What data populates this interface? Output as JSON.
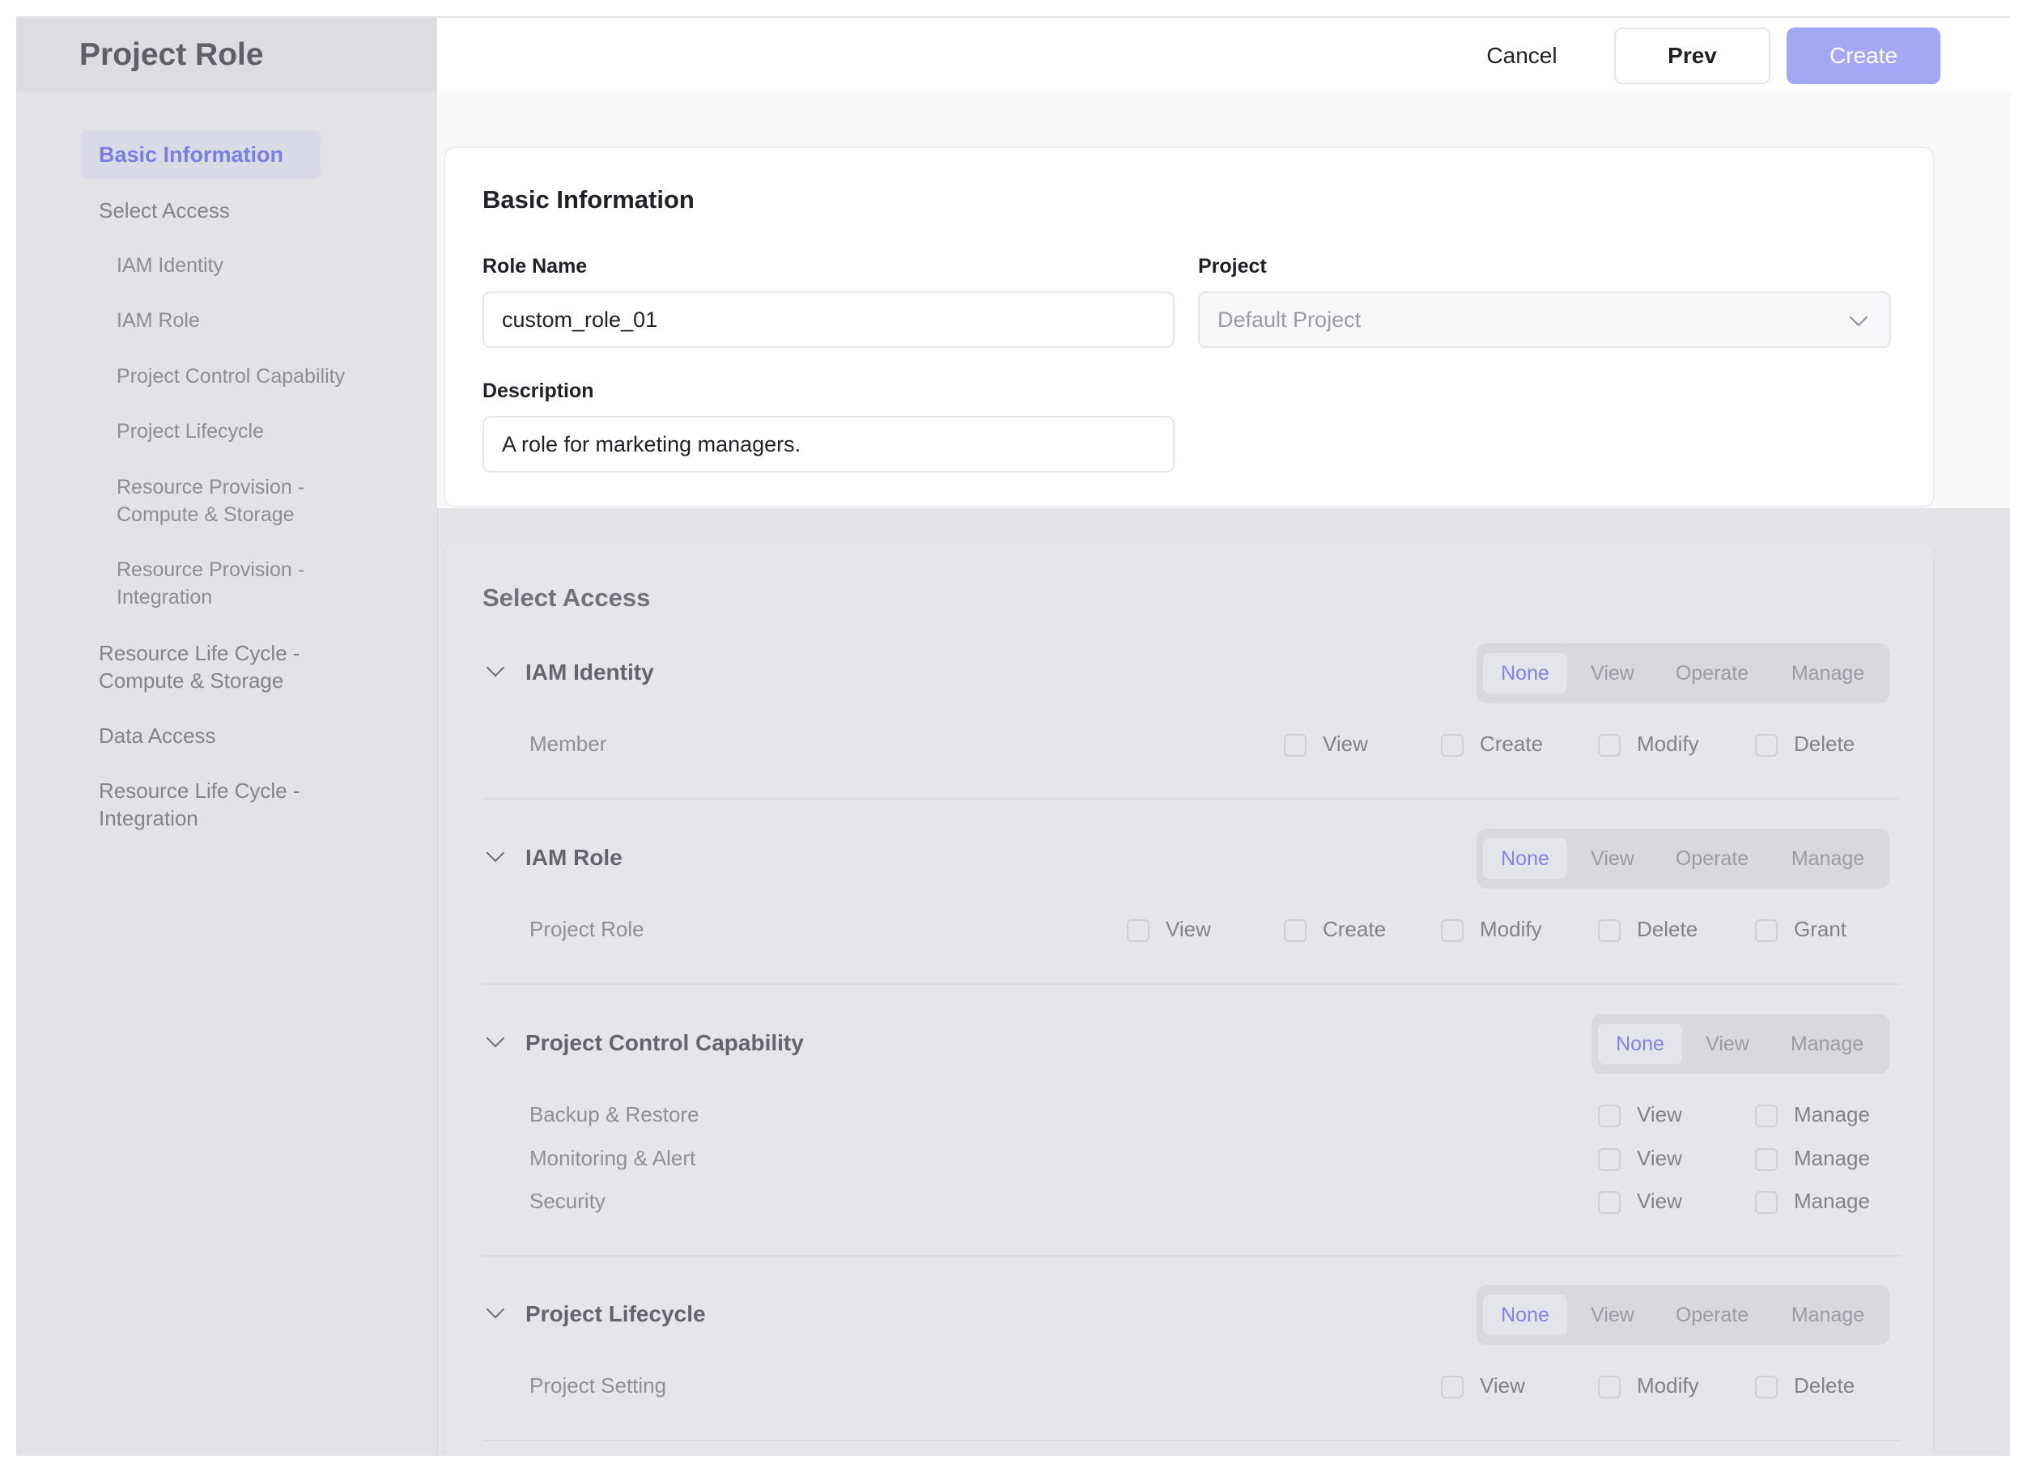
{
  "sidebar": {
    "title": "Project Role",
    "items": [
      {
        "label": "Basic Information"
      },
      {
        "label": "Select Access"
      },
      {
        "label": "IAM Identity"
      },
      {
        "label": "IAM Role"
      },
      {
        "label": "Project Control Capability"
      },
      {
        "label": "Project Lifecycle"
      },
      {
        "label": "Resource Provision -"
      },
      {
        "label": "Compute & Storage"
      },
      {
        "label": "Resource Provision -"
      },
      {
        "label": "Integration"
      },
      {
        "label": "Resource Life Cycle -"
      },
      {
        "label": "Compute & Storage"
      },
      {
        "label": "Data Access"
      },
      {
        "label": "Resource Life Cycle -"
      },
      {
        "label": "Integration"
      }
    ]
  },
  "header": {
    "cancel": "Cancel",
    "prev": "Prev",
    "create": "Create"
  },
  "basic": {
    "title": "Basic Information",
    "role_name_label": "Role Name",
    "role_name_value": "custom_role_01",
    "project_label": "Project",
    "project_value": "Default Project",
    "description_label": "Description",
    "description_value": "A role for marketing managers."
  },
  "access": {
    "title": "Select Access",
    "sections": [
      {
        "title": "IAM Identity",
        "levels": [
          "None",
          "View",
          "Operate",
          "Manage"
        ],
        "selected": "None",
        "rows": [
          {
            "label": "Member",
            "perms": [
              "View",
              "Create",
              "Modify",
              "Delete"
            ]
          }
        ]
      },
      {
        "title": "IAM Role",
        "levels": [
          "None",
          "View",
          "Operate",
          "Manage"
        ],
        "selected": "None",
        "rows": [
          {
            "label": "Project Role",
            "perms": [
              "View",
              "Create",
              "Modify",
              "Delete",
              "Grant"
            ]
          }
        ]
      },
      {
        "title": "Project Control Capability",
        "levels": [
          "None",
          "View",
          "Manage"
        ],
        "selected": "None",
        "rows": [
          {
            "label": "Backup & Restore",
            "perms": [
              "View",
              "Manage"
            ]
          },
          {
            "label": "Monitoring & Alert",
            "perms": [
              "View",
              "Manage"
            ]
          },
          {
            "label": "Security",
            "perms": [
              "View",
              "Manage"
            ]
          }
        ]
      },
      {
        "title": "Project Lifecycle",
        "levels": [
          "None",
          "View",
          "Operate",
          "Manage"
        ],
        "selected": "None",
        "rows": [
          {
            "label": "Project Setting",
            "perms": [
              "View",
              "Modify",
              "Delete"
            ]
          }
        ]
      }
    ]
  },
  "colors": {
    "accent": "#7a7fe2",
    "create_button": "#a4a8f4",
    "overlay": "#e3e4e8"
  },
  "icons": {
    "project_dropdown": "chevron-down-icon",
    "section_toggle": "chevron-down-icon"
  }
}
